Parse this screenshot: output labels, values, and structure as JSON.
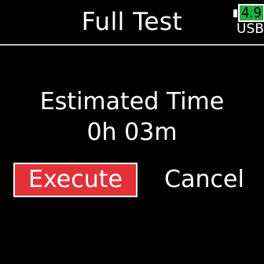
{
  "header": {
    "title": "Full Test"
  },
  "battery": {
    "level": "4.9",
    "source": "USB",
    "color": "#1fae3a"
  },
  "estimate": {
    "label": "Estimated Time",
    "value": "0h 03m"
  },
  "actions": {
    "execute_label": "Execute",
    "cancel_label": "Cancel",
    "selected": "execute",
    "selected_color": "#e3313a"
  }
}
